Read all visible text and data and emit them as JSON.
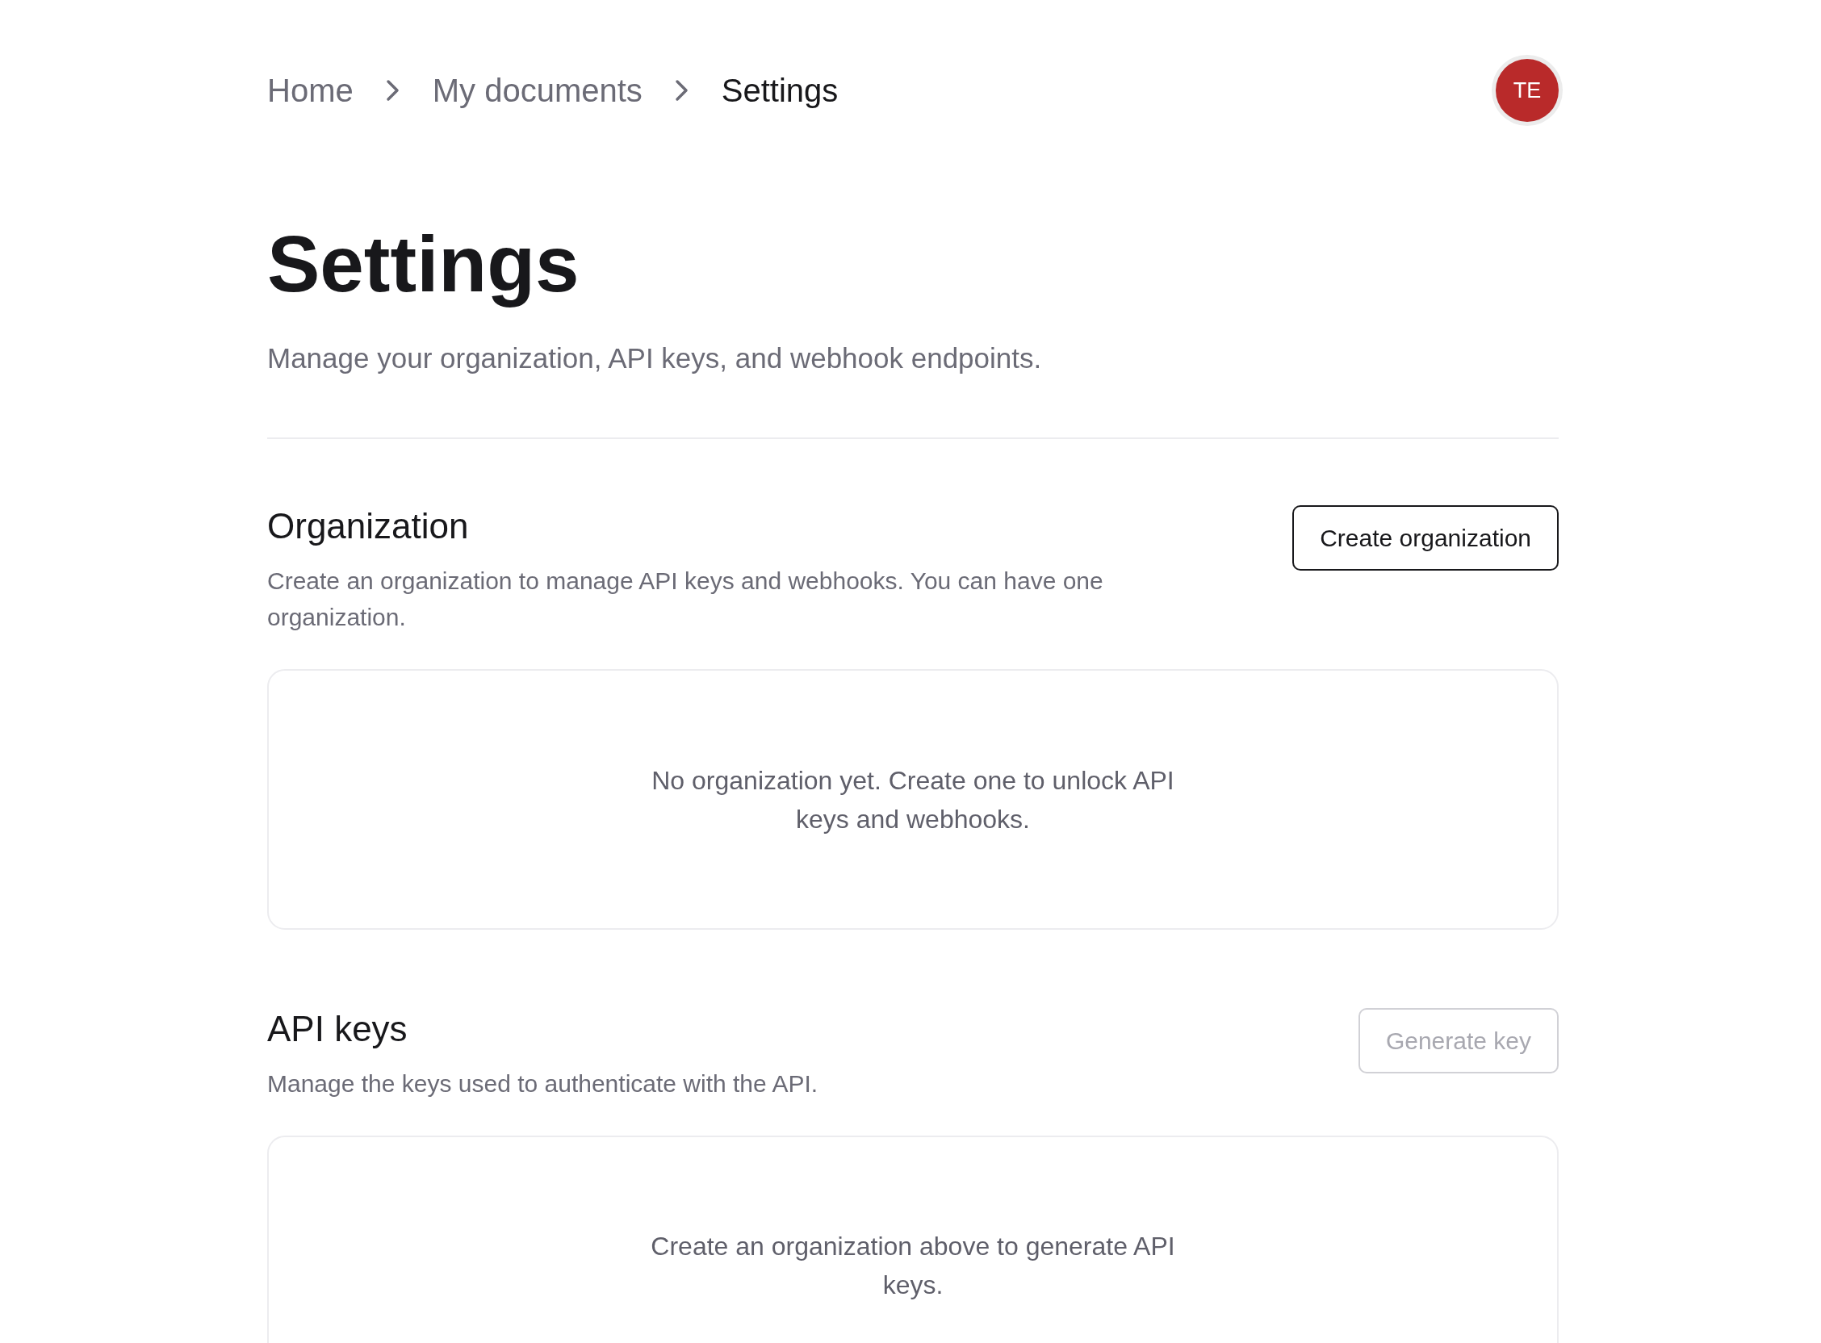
{
  "breadcrumb": [
    {
      "label": "Home",
      "selected": false
    },
    {
      "label": "My documents",
      "selected": false
    },
    {
      "label": "Settings",
      "selected": true
    }
  ],
  "avatar": {
    "initials": "TE"
  },
  "title": "Settings",
  "subtitle": "Manage your organization, API keys, and webhook endpoints.",
  "sections": [
    {
      "heading": "Organization",
      "description": "Create an organization to manage API keys and webhooks. You can have one organization.",
      "button": {
        "label": "Create organization",
        "disabled": false
      },
      "empty_message": "No organization yet. Create one to unlock API keys and webhooks."
    },
    {
      "heading": "API keys",
      "description": "Manage the keys used to authenticate with the API.",
      "button": {
        "label": "Generate key",
        "disabled": true
      },
      "empty_message": "Create an organization above to generate API keys."
    }
  ]
}
